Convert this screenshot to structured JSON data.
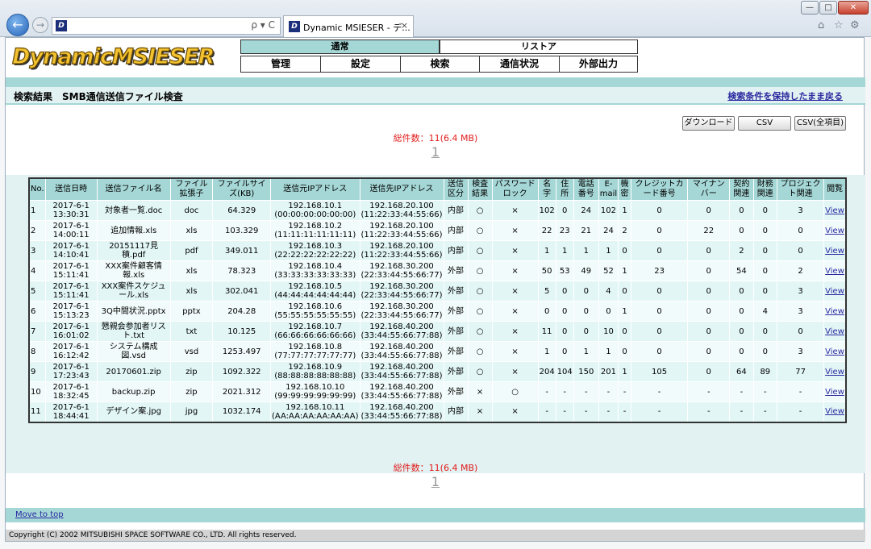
{
  "browser": {
    "tab_title": "Dynamic MSIESER - デ...",
    "tab_close": "×",
    "address_controls": "ρ ▾ C",
    "favicon_letter": "D",
    "back_symbol": "←",
    "forward_symbol": "→",
    "window_controls": {
      "minimize": "—",
      "maximize": "□",
      "close": "✕"
    },
    "toolbar_icons": {
      "home": "⌂",
      "favorites": "☆",
      "tools": "⚙"
    }
  },
  "app": {
    "logo": "DynamicMSIESER",
    "menu": {
      "tab_normal": "通常",
      "tab_restore": "リストア",
      "items": [
        "管理",
        "設定",
        "検索",
        "通信状況",
        "外部出力"
      ]
    },
    "title": "検索結果　SMB通信送信ファイル検査",
    "back_link": "検索条件を保持したまま戻る",
    "buttons": {
      "download": "ダウンロード",
      "csv": "CSV",
      "csv_all": "CSV(全項目)"
    },
    "total": "総件数：11(6.4 MB)",
    "page_number": "1",
    "footer_link": "Move to top",
    "copyright": "Copyright (C) 2002 MITSUBISHI SPACE SOFTWARE CO., LTD. All rights reserved."
  },
  "table": {
    "headers": [
      "No.",
      "送信日時",
      "送信ファイル名",
      "ファイル拡張子",
      "ファイルサイズ(KB)",
      "送信元IPアドレス",
      "送信先IPアドレス",
      "送信区分",
      "検査結果",
      "パスワードロック",
      "名字",
      "住所",
      "電話番号",
      "E-mail",
      "機密",
      "クレジットカード番号",
      "マイナンバー",
      "契約関連",
      "財務関連",
      "プロジェクト関連",
      "閲覧"
    ],
    "rows": [
      [
        "1",
        "2017-6-1 13:30:31",
        "対象者一覧.doc",
        "doc",
        "64.329",
        "192.168.10.1 (00:00:00:00:00:00)",
        "192.168.20.100 (11:22:33:44:55:66)",
        "内部",
        "○",
        "×",
        "102",
        "0",
        "24",
        "102",
        "1",
        "0",
        "0",
        "0",
        "0",
        "3",
        "View"
      ],
      [
        "2",
        "2017-6-1 14:00:11",
        "追加情報.xls",
        "xls",
        "103.329",
        "192.168.10.2 (11:11:11:11:11:11)",
        "192.168.20.100 (11:22:33:44:55:66)",
        "内部",
        "○",
        "×",
        "22",
        "23",
        "21",
        "24",
        "2",
        "0",
        "22",
        "0",
        "0",
        "0",
        "View"
      ],
      [
        "3",
        "2017-6-1 14:10:41",
        "20151117見積.pdf",
        "pdf",
        "349.011",
        "192.168.10.3 (22:22:22:22:22:22)",
        "192.168.20.100 (11:22:33:44:55:66)",
        "内部",
        "○",
        "×",
        "1",
        "1",
        "1",
        "1",
        "0",
        "0",
        "0",
        "2",
        "0",
        "0",
        "View"
      ],
      [
        "4",
        "2017-6-1 15:11:41",
        "XXX案件顧客情報.xls",
        "xls",
        "78.323",
        "192.168.10.4 (33:33:33:33:33:33)",
        "192.168.30.200 (22:33:44:55:66:77)",
        "外部",
        "○",
        "×",
        "50",
        "53",
        "49",
        "52",
        "1",
        "23",
        "0",
        "54",
        "0",
        "2",
        "View"
      ],
      [
        "5",
        "2017-6-1 15:11:41",
        "XXX案件スケジュール.xls",
        "xls",
        "302.041",
        "192.168.10.5 (44:44:44:44:44:44)",
        "192.168.30.200 (22:33:44:55:66:77)",
        "外部",
        "○",
        "×",
        "5",
        "0",
        "0",
        "4",
        "0",
        "0",
        "0",
        "0",
        "0",
        "3",
        "View"
      ],
      [
        "6",
        "2017-6-1 15:13:23",
        "3Q中間状況.pptx",
        "pptx",
        "204.28",
        "192.168.10.6 (55:55:55:55:55:55)",
        "192.168.30.200 (22:33:44:55:66:77)",
        "外部",
        "○",
        "×",
        "0",
        "0",
        "0",
        "0",
        "1",
        "0",
        "0",
        "0",
        "4",
        "3",
        "View"
      ],
      [
        "7",
        "2017-6-1 16:01:02",
        "懇親会参加者リスト.txt",
        "txt",
        "10.125",
        "192.168.10.7 (66:66:66:66:66:66)",
        "192.168.40.200 (33:44:55:66:77:88)",
        "外部",
        "○",
        "×",
        "11",
        "0",
        "0",
        "10",
        "0",
        "0",
        "0",
        "0",
        "0",
        "0",
        "View"
      ],
      [
        "8",
        "2017-6-1 16:12:42",
        "システム構成図.vsd",
        "vsd",
        "1253.497",
        "192.168.10.8 (77:77:77:77:77:77)",
        "192.168.40.200 (33:44:55:66:77:88)",
        "外部",
        "○",
        "×",
        "1",
        "0",
        "1",
        "1",
        "0",
        "0",
        "0",
        "0",
        "0",
        "3",
        "View"
      ],
      [
        "9",
        "2017-6-1 17:23:43",
        "20170601.zip",
        "zip",
        "1092.322",
        "192.168.10.9 (88:88:88:88:88:88)",
        "192.168.40.200 (33:44:55:66:77:88)",
        "外部",
        "○",
        "×",
        "204",
        "104",
        "150",
        "201",
        "1",
        "105",
        "0",
        "64",
        "89",
        "77",
        "View"
      ],
      [
        "10",
        "2017-6-1 18:32:45",
        "backup.zip",
        "zip",
        "2021.312",
        "192.168.10.10 (99:99:99:99:99:99)",
        "192.168.40.200 (33:44:55:66:77:88)",
        "外部",
        "×",
        "○",
        "-",
        "-",
        "-",
        "-",
        "-",
        "-",
        "-",
        "-",
        "-",
        "-",
        "View"
      ],
      [
        "11",
        "2017-6-1 18:44:41",
        "デザイン案.jpg",
        "jpg",
        "1032.174",
        "192.168.10.11 (AA:AA:AA:AA:AA:AA)",
        "192.168.40.200 (33:44:55:66:77:88)",
        "内部",
        "×",
        "×",
        "-",
        "-",
        "-",
        "-",
        "-",
        "-",
        "-",
        "-",
        "-",
        "-",
        "View"
      ]
    ]
  }
}
